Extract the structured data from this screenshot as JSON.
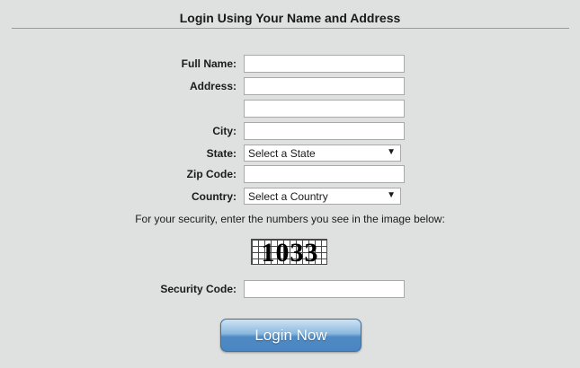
{
  "form": {
    "title": "Login Using Your Name and Address",
    "fields": {
      "full_name": {
        "label": "Full Name:",
        "value": ""
      },
      "address": {
        "label": "Address:",
        "value": "",
        "value2": ""
      },
      "city": {
        "label": "City:",
        "value": ""
      },
      "state": {
        "label": "State:",
        "selected": "Select a State"
      },
      "zip": {
        "label": "Zip Code:",
        "value": ""
      },
      "country": {
        "label": "Country:",
        "selected": "Select a Country"
      },
      "security": {
        "label": "Security Code:",
        "value": ""
      }
    },
    "security_note": "For your security, enter the numbers you see in the image below:",
    "captcha_text": "1033",
    "submit_label": "Login Now",
    "dropdown_arrow": "▼"
  }
}
